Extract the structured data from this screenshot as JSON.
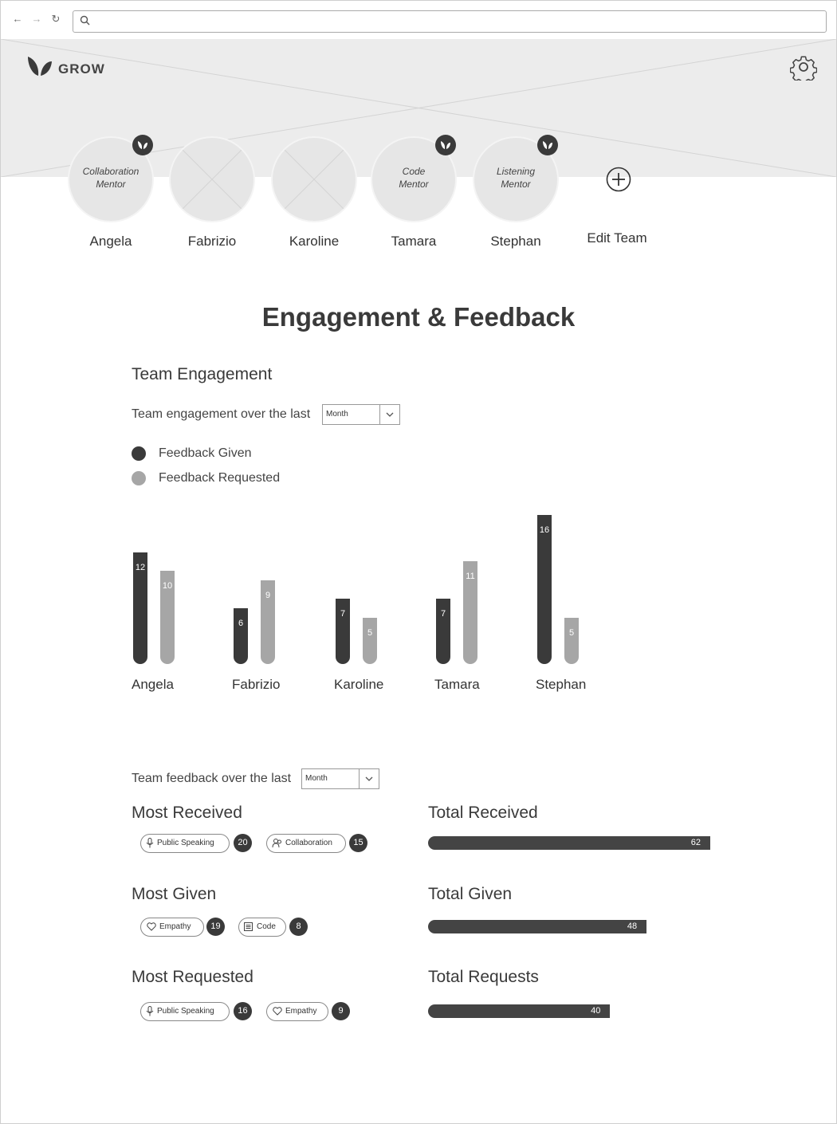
{
  "app": {
    "name": "GROW"
  },
  "team": [
    {
      "name": "Angela",
      "role": [
        "Collaboration",
        "Mentor"
      ],
      "mentor": true
    },
    {
      "name": "Fabrizio",
      "role": [],
      "mentor": false
    },
    {
      "name": "Karoline",
      "role": [],
      "mentor": false
    },
    {
      "name": "Tamara",
      "role": [
        "Code",
        "Mentor"
      ],
      "mentor": true
    },
    {
      "name": "Stephan",
      "role": [
        "Listening",
        "Mentor"
      ],
      "mentor": true
    }
  ],
  "edit_team_label": "Edit Team",
  "page_title": "Engagement & Feedback",
  "engagement": {
    "heading": "Team Engagement",
    "period_label": "Team engagement over the last",
    "period_value": "Month",
    "legend": [
      {
        "label": "Feedback Given",
        "color": "#3a3a3a"
      },
      {
        "label": "Feedback Requested",
        "color": "#a6a6a6"
      }
    ]
  },
  "chart_data": {
    "type": "bar",
    "categories": [
      "Angela",
      "Fabrizio",
      "Karoline",
      "Tamara",
      "Stephan"
    ],
    "series": [
      {
        "name": "Feedback Given",
        "values": [
          12,
          6,
          7,
          7,
          16
        ],
        "color": "#3a3a3a"
      },
      {
        "name": "Feedback Requested",
        "values": [
          10,
          9,
          5,
          11,
          5
        ],
        "color": "#a6a6a6"
      }
    ],
    "grid": false,
    "legend": "top-left"
  },
  "feedback": {
    "period_label": "Team feedback over the last",
    "period_value": "Month",
    "most_received": {
      "heading": "Most Received",
      "items": [
        {
          "label": "Public Speaking",
          "icon": "microphone-icon",
          "count": "20"
        },
        {
          "label": "Collaboration",
          "icon": "collaboration-icon",
          "count": "15"
        }
      ]
    },
    "most_given": {
      "heading": "Most Given",
      "items": [
        {
          "label": "Empathy",
          "icon": "heart-icon",
          "count": "19"
        },
        {
          "label": "Code",
          "icon": "code-icon",
          "count": "8"
        }
      ]
    },
    "most_requested": {
      "heading": "Most Requested",
      "items": [
        {
          "label": "Public Speaking",
          "icon": "microphone-icon",
          "count": "16"
        },
        {
          "label": "Empathy",
          "icon": "heart-icon",
          "count": "9"
        }
      ]
    },
    "totals": [
      {
        "heading": "Total Received",
        "value": 62
      },
      {
        "heading": "Total Given",
        "value": 48
      },
      {
        "heading": "Total Requests",
        "value": 40
      }
    ]
  }
}
